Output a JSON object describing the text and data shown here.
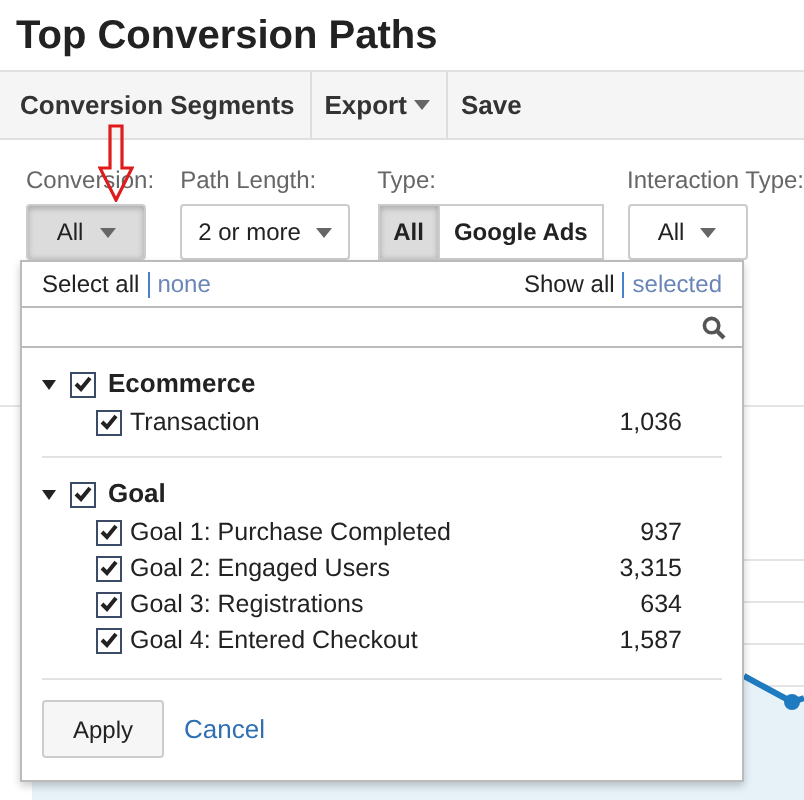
{
  "title": "Top Conversion Paths",
  "toolbar": [
    {
      "label": "Conversion Segments",
      "dropdown": false
    },
    {
      "label": "Export",
      "dropdown": true
    },
    {
      "label": "Save",
      "dropdown": false
    }
  ],
  "filters": [
    {
      "kind": "dropdown",
      "label": "Conversion:",
      "value": "All",
      "active": true
    },
    {
      "kind": "dropdown",
      "label": "Path Length:",
      "value": "2 or more",
      "active": false
    },
    {
      "kind": "toggle",
      "label": "Type:",
      "options": [
        {
          "label": "All",
          "selected": true
        },
        {
          "label": "Google Ads",
          "selected": false
        }
      ]
    },
    {
      "kind": "dropdown",
      "label": "Interaction Type:",
      "value": "All",
      "active": false
    }
  ],
  "panel": {
    "select_all": "Select all",
    "none": "none",
    "show_all": "Show all",
    "selected_link": "selected",
    "groups": [
      {
        "label": "Ecommerce",
        "expanded": true,
        "checked": true,
        "items": [
          {
            "label": "Transaction",
            "count": "1,036",
            "checked": true
          }
        ]
      },
      {
        "label": "Goal",
        "expanded": true,
        "checked": true,
        "items": [
          {
            "label": "Goal 1: Purchase Completed",
            "count": "937",
            "checked": true
          },
          {
            "label": "Goal 2: Engaged Users",
            "count": "3,315",
            "checked": true
          },
          {
            "label": "Goal 3: Registrations",
            "count": "634",
            "checked": true
          },
          {
            "label": "Goal 4: Entered Checkout",
            "count": "1,587",
            "checked": true
          }
        ]
      }
    ],
    "apply": "Apply",
    "cancel": "Cancel"
  }
}
